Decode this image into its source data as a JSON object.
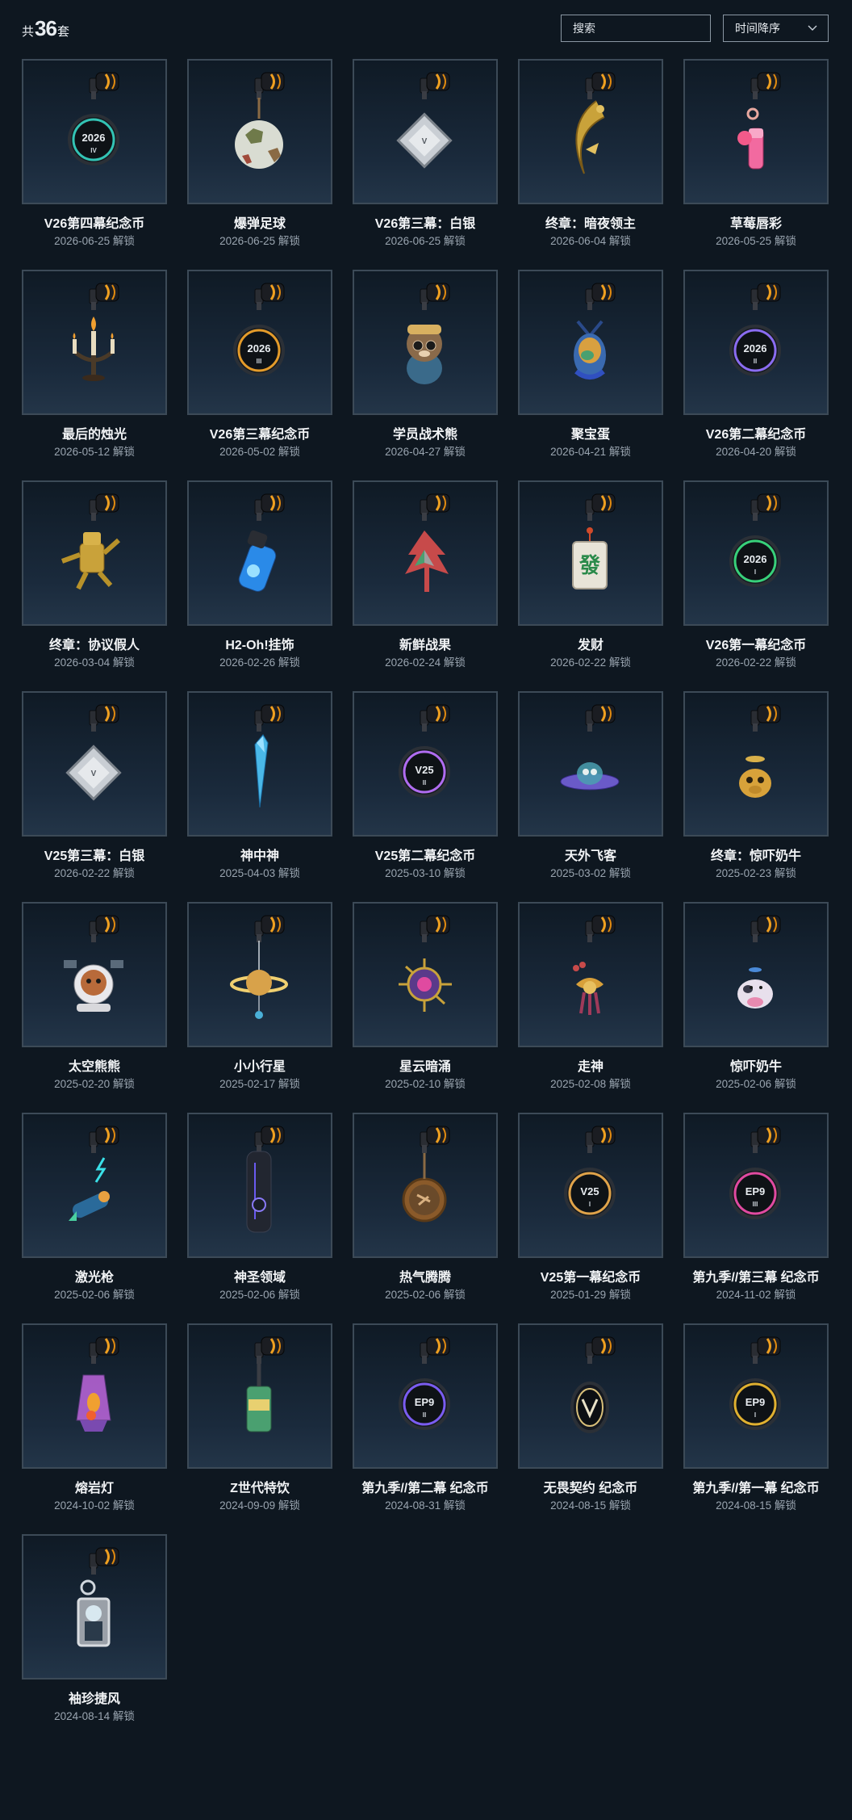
{
  "header": {
    "count_prefix": "共",
    "count_value": "36",
    "count_suffix": "套",
    "search_placeholder": "搜索",
    "sort_label": "时间降序"
  },
  "colors": {
    "background": "#0e1720",
    "tile_border": "#3c4a57",
    "clip_gold": "#f0a020"
  },
  "items": [
    {
      "name": "V26第四幕纪念币",
      "date": "2026-06-25 解锁",
      "icon": "coin-iv-icon"
    },
    {
      "name": "爆弹足球",
      "date": "2026-06-25 解锁",
      "icon": "soccer-ball-icon"
    },
    {
      "name": "V26第三幕：白银",
      "date": "2026-06-25 解锁",
      "icon": "silver-diamond-icon"
    },
    {
      "name": "终章：暗夜领主",
      "date": "2026-06-04 解锁",
      "icon": "golden-crescent-icon"
    },
    {
      "name": "草莓唇彩",
      "date": "2026-05-25 解锁",
      "icon": "lip-gloss-icon"
    },
    {
      "name": "最后的烛光",
      "date": "2026-05-12 解锁",
      "icon": "candelabra-icon"
    },
    {
      "name": "V26第三幕纪念币",
      "date": "2026-05-02 解锁",
      "icon": "coin-iii-icon"
    },
    {
      "name": "学员战术熊",
      "date": "2026-04-27 解锁",
      "icon": "tactical-bear-icon"
    },
    {
      "name": "聚宝蛋",
      "date": "2026-04-21 解锁",
      "icon": "jewel-egg-icon"
    },
    {
      "name": "V26第二幕纪念币",
      "date": "2026-04-20 解锁",
      "icon": "coin-ii-icon"
    },
    {
      "name": "终章：协议假人",
      "date": "2026-03-04 解锁",
      "icon": "golden-dummy-icon"
    },
    {
      "name": "H2-Oh!挂饰",
      "date": "2026-02-26 解锁",
      "icon": "water-bottle-icon"
    },
    {
      "name": "新鲜战果",
      "date": "2026-02-24 解锁",
      "icon": "leaf-fruit-icon"
    },
    {
      "name": "发财",
      "date": "2026-02-22 解锁",
      "icon": "mahjong-tile-icon"
    },
    {
      "name": "V26第一幕纪念币",
      "date": "2026-02-22 解锁",
      "icon": "coin-i-icon"
    },
    {
      "name": "V25第三幕：白银",
      "date": "2026-02-22 解锁",
      "icon": "silver-diamond-icon"
    },
    {
      "name": "神中神",
      "date": "2025-04-03 解锁",
      "icon": "crystal-blade-icon"
    },
    {
      "name": "V25第二幕纪念币",
      "date": "2025-03-10 解锁",
      "icon": "coin-v25-ii-icon"
    },
    {
      "name": "天外飞客",
      "date": "2025-03-02 解锁",
      "icon": "ufo-icon"
    },
    {
      "name": "终章：惊吓奶牛",
      "date": "2025-02-23 解锁",
      "icon": "golden-cow-icon"
    },
    {
      "name": "太空熊熊",
      "date": "2025-02-20 解锁",
      "icon": "space-bear-icon"
    },
    {
      "name": "小小行星",
      "date": "2025-02-17 解锁",
      "icon": "planet-icon"
    },
    {
      "name": "星云暗涌",
      "date": "2025-02-10 解锁",
      "icon": "nebula-wheel-icon"
    },
    {
      "name": "走神",
      "date": "2025-02-08 解锁",
      "icon": "spirit-icon"
    },
    {
      "name": "惊吓奶牛",
      "date": "2025-02-06 解锁",
      "icon": "cow-icon"
    },
    {
      "name": "激光枪",
      "date": "2025-02-06 解锁",
      "icon": "laser-gun-icon"
    },
    {
      "name": "神圣领域",
      "date": "2025-02-06 解锁",
      "icon": "sacred-plate-icon"
    },
    {
      "name": "热气腾腾",
      "date": "2025-02-06 解锁",
      "icon": "hot-pot-icon"
    },
    {
      "name": "V25第一幕纪念币",
      "date": "2025-01-29 解锁",
      "icon": "coin-v25-i-icon"
    },
    {
      "name": "第九季//第三幕 纪念币",
      "date": "2024-11-02 解锁",
      "icon": "coin-ep9-iii-icon"
    },
    {
      "name": "熔岩灯",
      "date": "2024-10-02 解锁",
      "icon": "lava-lamp-icon"
    },
    {
      "name": "Z世代特饮",
      "date": "2024-09-09 解锁",
      "icon": "soda-can-icon"
    },
    {
      "name": "第九季//第二幕 纪念币",
      "date": "2024-08-31 解锁",
      "icon": "coin-ep9-ii-icon"
    },
    {
      "name": "无畏契约 纪念币",
      "date": "2024-08-15 解锁",
      "icon": "coin-valorant-icon"
    },
    {
      "name": "第九季//第一幕 纪念币",
      "date": "2024-08-15 解锁",
      "icon": "coin-ep9-i-icon"
    },
    {
      "name": "袖珍捷风",
      "date": "2024-08-14 解锁",
      "icon": "mini-jett-icon"
    }
  ]
}
